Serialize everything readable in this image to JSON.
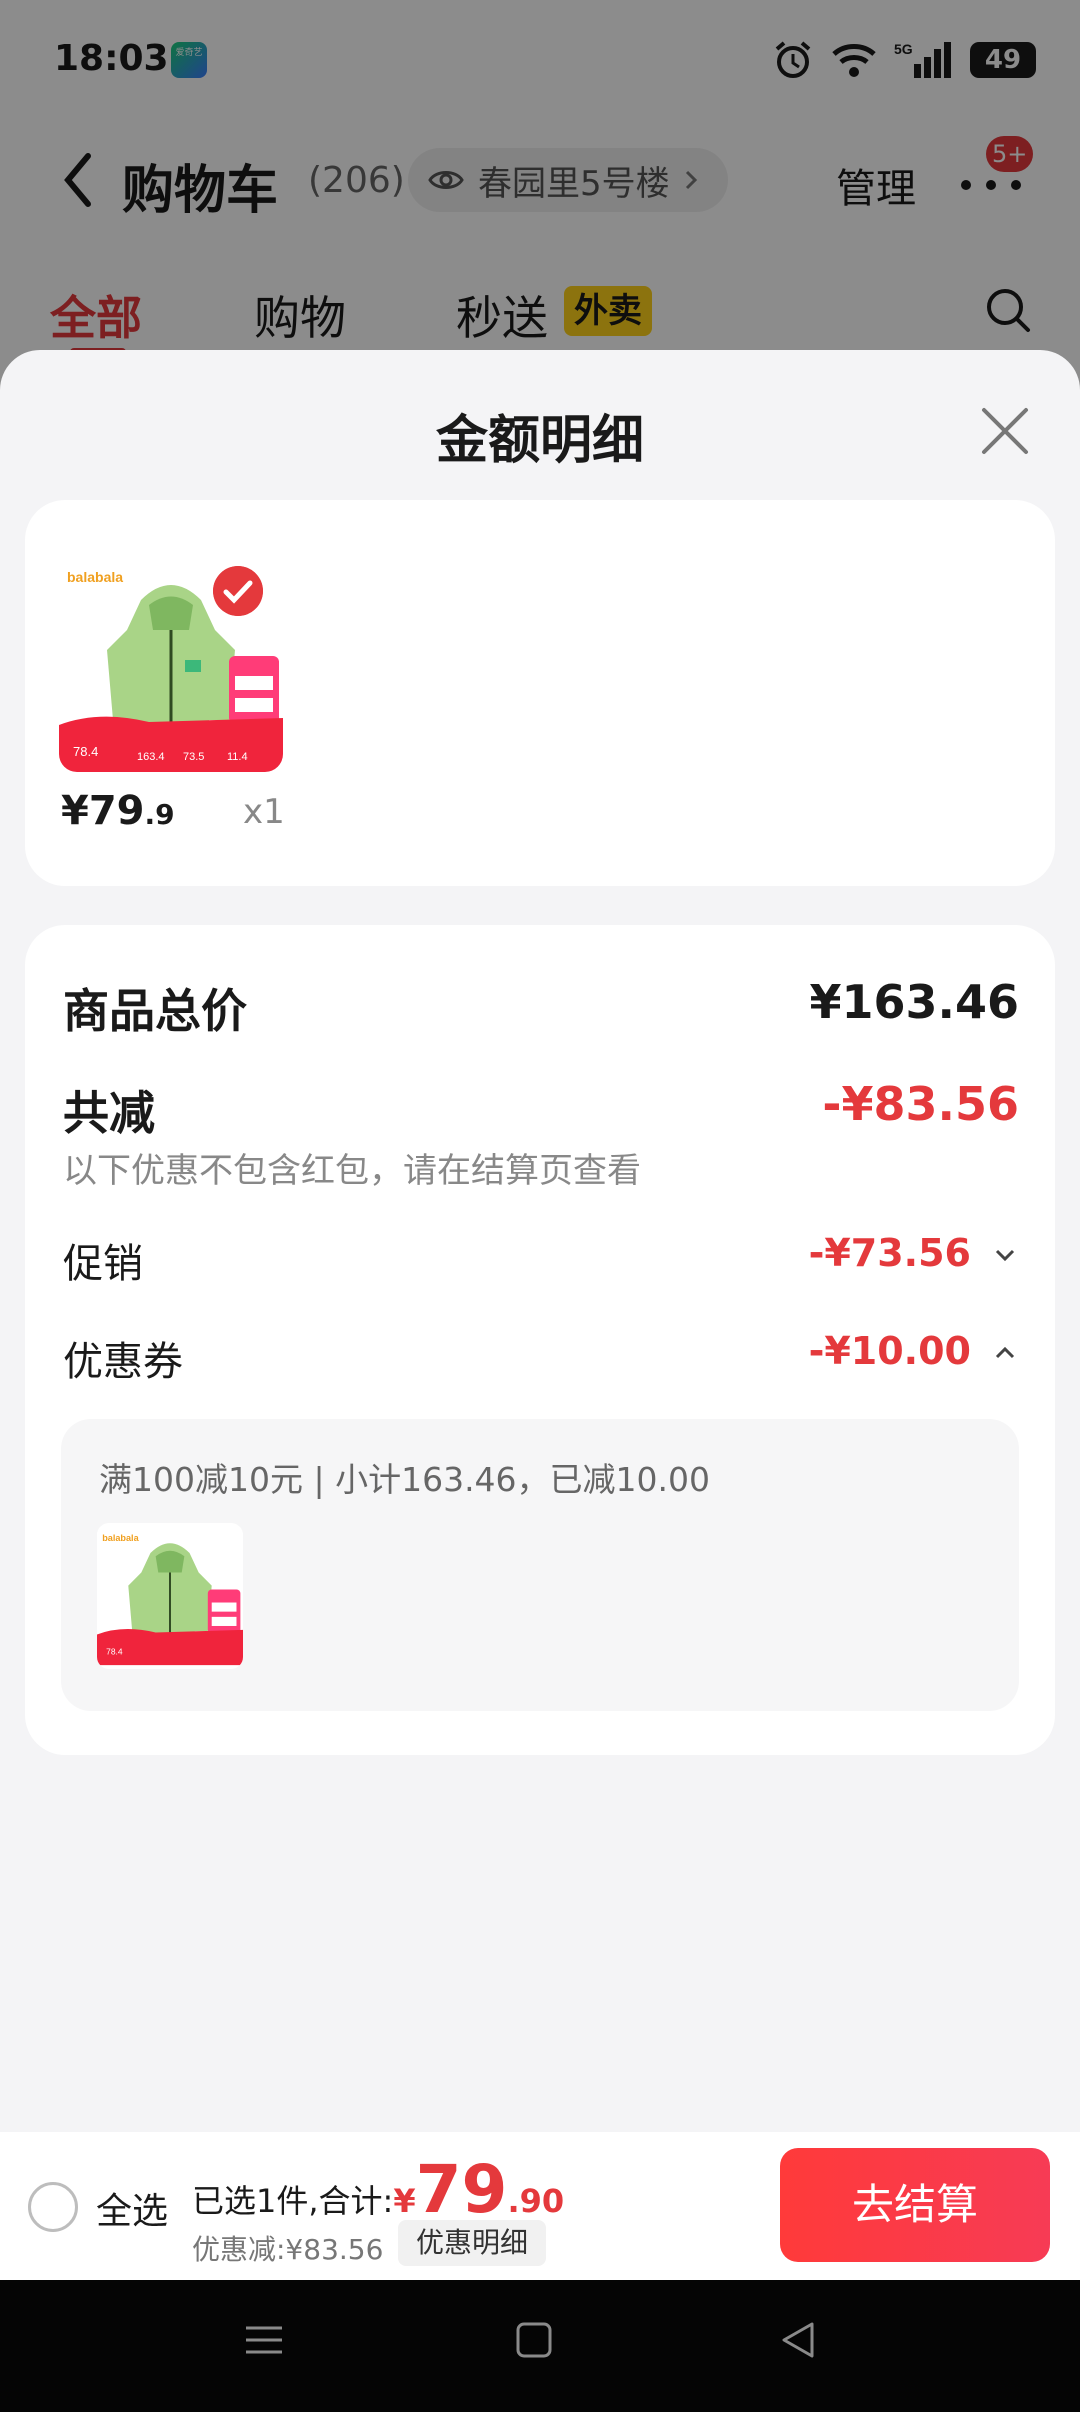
{
  "status_bar": {
    "time": "18:03",
    "app_icon_text": "爱奇艺",
    "network": "5G",
    "battery": "49"
  },
  "header": {
    "title": "购物车",
    "count": "(206)",
    "location": "春园里5号楼",
    "manage": "管理",
    "badge": "5+"
  },
  "tabs": [
    {
      "label": "全部"
    },
    {
      "label": "购物"
    },
    {
      "label": "秒送"
    }
  ],
  "tab_tag": "外卖",
  "sheet": {
    "title": "金额明细",
    "product": {
      "price_main": "¥79",
      "price_decimal": ".9",
      "qty": "x1",
      "brand": "balabala"
    },
    "rows": {
      "total_label": "商品总价",
      "total_value": "¥163.46",
      "reduce_label": "共减",
      "reduce_value": "-¥83.56",
      "note": "以下优惠不包含红包，请在结算页查看",
      "promo_label": "促销",
      "promo_value": "-¥73.56",
      "coupon_label": "优惠券",
      "coupon_value": "-¥10.00"
    },
    "coupon_detail": "满100减10元 | 小计163.46，已减10.00"
  },
  "bottom": {
    "select_all": "全选",
    "summary_prefix": "已选1件,合计:",
    "currency": "¥",
    "amount_int": "79",
    "amount_dec": ".90",
    "discount": "优惠减:¥83.56",
    "detail_button": "优惠明细",
    "checkout": "去结算"
  },
  "colors": {
    "accent": "#e4393c",
    "tag_yellow": "#ffd21a"
  }
}
